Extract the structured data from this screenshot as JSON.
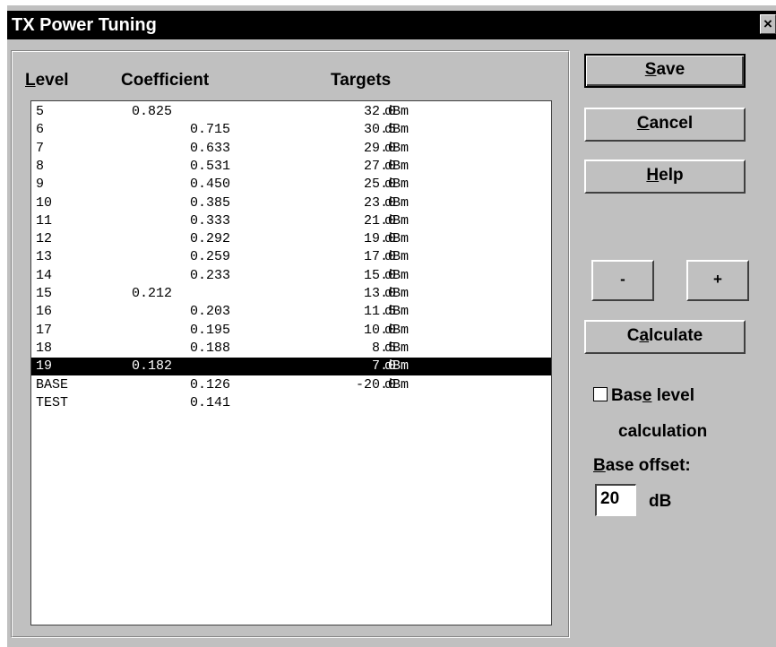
{
  "window": {
    "title": "TX Power Tuning",
    "close_glyph": "×"
  },
  "columns": {
    "level_rest": "evel",
    "level_key": "L",
    "coefficient": "Coefficient",
    "targets": "Targets"
  },
  "rows": [
    {
      "level": "5",
      "coefficient": "0.825",
      "coef_align": "left",
      "target": "32.0",
      "unit": "dBm"
    },
    {
      "level": "6",
      "coefficient": "0.715",
      "coef_align": "right",
      "target": "30.5",
      "unit": "dBm"
    },
    {
      "level": "7",
      "coefficient": "0.633",
      "coef_align": "right",
      "target": "29.0",
      "unit": "dBm"
    },
    {
      "level": "8",
      "coefficient": "0.531",
      "coef_align": "right",
      "target": "27.0",
      "unit": "dBm"
    },
    {
      "level": "9",
      "coefficient": "0.450",
      "coef_align": "right",
      "target": "25.0",
      "unit": "dBm"
    },
    {
      "level": "10",
      "coefficient": "0.385",
      "coef_align": "right",
      "target": "23.0",
      "unit": "dBm"
    },
    {
      "level": "11",
      "coefficient": "0.333",
      "coef_align": "right",
      "target": "21.0",
      "unit": "dBm"
    },
    {
      "level": "12",
      "coefficient": "0.292",
      "coef_align": "right",
      "target": "19.0",
      "unit": "dBm"
    },
    {
      "level": "13",
      "coefficient": "0.259",
      "coef_align": "right",
      "target": "17.0",
      "unit": "dBm"
    },
    {
      "level": "14",
      "coefficient": "0.233",
      "coef_align": "right",
      "target": "15.0",
      "unit": "dBm"
    },
    {
      "level": "15",
      "coefficient": "0.212",
      "coef_align": "left",
      "target": "13.0",
      "unit": "dBm"
    },
    {
      "level": "16",
      "coefficient": "0.203",
      "coef_align": "right",
      "target": "11.5",
      "unit": "dBm"
    },
    {
      "level": "17",
      "coefficient": "0.195",
      "coef_align": "right",
      "target": "10.0",
      "unit": "dBm"
    },
    {
      "level": "18",
      "coefficient": "0.188",
      "coef_align": "right",
      "target": "8.5",
      "unit": "dBm"
    },
    {
      "level": "19",
      "coefficient": "0.182",
      "coef_align": "left",
      "target": "7.0",
      "unit": "dBm",
      "selected": true
    },
    {
      "level": "BASE",
      "coefficient": "0.126",
      "coef_align": "right",
      "target": "-20.0",
      "unit": "dBm"
    },
    {
      "level": "TEST",
      "coefficient": "0.141",
      "coef_align": "right",
      "target": "",
      "unit": ""
    }
  ],
  "buttons": {
    "save_key": "S",
    "save_rest": "ave",
    "cancel_key": "C",
    "cancel_rest": "ancel",
    "help_key": "H",
    "help_rest": "elp",
    "minus": "-",
    "plus": "+",
    "calc_pre": "C",
    "calc_key": "a",
    "calc_rest": "lculate"
  },
  "options": {
    "base_level_pre": "Bas",
    "base_level_key": "e",
    "base_level_rest": " level",
    "base_level_line2": "calculation",
    "base_level_checked": false,
    "offset_key": "B",
    "offset_rest": "ase offset:",
    "offset_value": "20",
    "offset_unit": "dB"
  }
}
